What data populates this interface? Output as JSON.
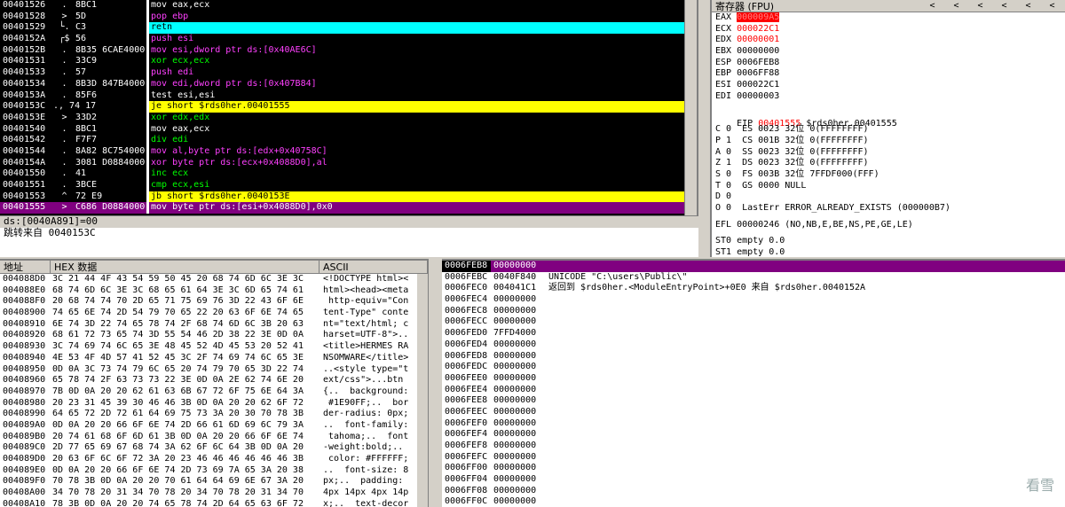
{
  "disasm": [
    {
      "addr": "00401526",
      "arrow": ".",
      "hex": "8BC1",
      "asm": "mov eax,ecx"
    },
    {
      "addr": "00401528",
      "arrow": ">",
      "hex": "5D",
      "asm": "pop ebp"
    },
    {
      "addr": "00401529",
      "arrow": "└.",
      "hex": "C3",
      "asm": "retn"
    },
    {
      "addr": "0040152A",
      "arrow": "┌$",
      "hex": "56",
      "asm": "push esi"
    },
    {
      "addr": "0040152B",
      "arrow": ".",
      "hex": "8B35 6CAE4000",
      "asm": "mov esi,dword ptr ds:[0x40AE6C]"
    },
    {
      "addr": "00401531",
      "arrow": ".",
      "hex": "33C9",
      "asm": "xor ecx,ecx"
    },
    {
      "addr": "00401533",
      "arrow": ".",
      "hex": "57",
      "asm": "push edi"
    },
    {
      "addr": "00401534",
      "arrow": ".",
      "hex": "8B3D 847B4000",
      "asm": "mov edi,dword ptr ds:[0x407B84]"
    },
    {
      "addr": "0040153A",
      "arrow": ".",
      "hex": "85F6",
      "asm": "test esi,esi"
    },
    {
      "addr": "0040153C",
      "arrow": "., 74 17",
      "hex": "",
      "asm": "je short $rds0her.00401555"
    },
    {
      "addr": "0040153E",
      "arrow": ">",
      "hex": "33D2",
      "asm": "xor edx,edx"
    },
    {
      "addr": "00401540",
      "arrow": ".",
      "hex": "8BC1",
      "asm": "mov eax,ecx"
    },
    {
      "addr": "00401542",
      "arrow": ".",
      "hex": "F7F7",
      "asm": "div edi"
    },
    {
      "addr": "00401544",
      "arrow": ".",
      "hex": "8A82 8C754000",
      "asm": "mov al,byte ptr ds:[edx+0x40758C]"
    },
    {
      "addr": "0040154A",
      "arrow": ".",
      "hex": "3081 D0884000",
      "asm": "xor byte ptr ds:[ecx+0x4088D0],al"
    },
    {
      "addr": "00401550",
      "arrow": ".",
      "hex": "41",
      "asm": "inc ecx"
    },
    {
      "addr": "00401551",
      "arrow": ".",
      "hex": "3BCE",
      "asm": "cmp ecx,esi"
    },
    {
      "addr": "00401553",
      "arrow": "^",
      "hex": "72 E9",
      "asm": "jb short $rds0her.0040153E"
    },
    {
      "addr": "00401555",
      "arrow": ">",
      "hex": "C686 D0884000",
      "asm": "mov byte ptr ds:[esi+0x4088D0],0x0"
    }
  ],
  "info": {
    "line1": "ds:[0040A891]=00",
    "line2": "跳转来自 0040153C"
  },
  "registers": {
    "title": "寄存器 (FPU)",
    "arrows": [
      "<",
      "<",
      "<",
      "<",
      "<",
      "<"
    ],
    "gp": [
      {
        "name": "EAX",
        "value": "000009A5"
      },
      {
        "name": "ECX",
        "value": "000022C1"
      },
      {
        "name": "EDX",
        "value": "00000001"
      },
      {
        "name": "EBX",
        "value": "00000000"
      },
      {
        "name": "ESP",
        "value": "0006FEB8"
      },
      {
        "name": "EBP",
        "value": "0006FF88"
      },
      {
        "name": "ESI",
        "value": "000022C1"
      },
      {
        "name": "EDI",
        "value": "00000003"
      }
    ],
    "eip": {
      "name": "EIP",
      "value": "00401555",
      "sym": "$rds0her.00401555"
    },
    "segs": [
      "C 0  ES 0023 32位 0(FFFFFFFF)",
      "P 1  CS 001B 32位 0(FFFFFFFF)",
      "A 0  SS 0023 32位 0(FFFFFFFF)",
      "Z 1  DS 0023 32位 0(FFFFFFFF)",
      "S 0  FS 003B 32位 7FFDF000(FFF)",
      "T 0  GS 0000 NULL",
      "D 0"
    ],
    "lasterr": "O 0  LastErr ERROR_ALREADY_EXISTS (000000B7)",
    "efl": "EFL 00000246 (NO,NB,E,BE,NS,PE,GE,LE)",
    "st0": "ST0 empty 0.0",
    "st1": "ST1 empty 0.0"
  },
  "dump": {
    "col_addr": "地址",
    "col_hex": "HEX 数据",
    "col_ascii": "ASCII",
    "rows": [
      {
        "addr": "004088D0",
        "hex": "3C 21 44 4F 43 54 59 50 45 20 68 74 6D 6C 3E 3C",
        "ascii": "<!DOCTYPE html><"
      },
      {
        "addr": "004088E0",
        "hex": "68 74 6D 6C 3E 3C 68 65 61 64 3E 3C 6D 65 74 61",
        "ascii": "html><head><meta"
      },
      {
        "addr": "004088F0",
        "hex": "20 68 74 74 70 2D 65 71 75 69 76 3D 22 43 6F 6E",
        "ascii": " http-equiv=\"Con"
      },
      {
        "addr": "00408900",
        "hex": "74 65 6E 74 2D 54 79 70 65 22 20 63 6F 6E 74 65",
        "ascii": "tent-Type\" conte"
      },
      {
        "addr": "00408910",
        "hex": "6E 74 3D 22 74 65 78 74 2F 68 74 6D 6C 3B 20 63",
        "ascii": "nt=\"text/html; c"
      },
      {
        "addr": "00408920",
        "hex": "68 61 72 73 65 74 3D 55 54 46 2D 38 22 3E 0D 0A",
        "ascii": "harset=UTF-8\">.."
      },
      {
        "addr": "00408930",
        "hex": "3C 74 69 74 6C 65 3E 48 45 52 4D 45 53 20 52 41",
        "ascii": "<title>HERMES RA"
      },
      {
        "addr": "00408940",
        "hex": "4E 53 4F 4D 57 41 52 45 3C 2F 74 69 74 6C 65 3E",
        "ascii": "NSOMWARE</title>"
      },
      {
        "addr": "00408950",
        "hex": "0D 0A 3C 73 74 79 6C 65 20 74 79 70 65 3D 22 74",
        "ascii": "..<style type=\"t"
      },
      {
        "addr": "00408960",
        "hex": "65 78 74 2F 63 73 73 22 3E 0D 0A 2E 62 74 6E 20",
        "ascii": "ext/css\">...btn "
      },
      {
        "addr": "00408970",
        "hex": "7B 0D 0A 20 20 62 61 63 6B 67 72 6F 75 6E 64 3A",
        "ascii": "{..  background:"
      },
      {
        "addr": "00408980",
        "hex": "20 23 31 45 39 30 46 46 3B 0D 0A 20 20 62 6F 72",
        "ascii": " #1E90FF;..  bor"
      },
      {
        "addr": "00408990",
        "hex": "64 65 72 2D 72 61 64 69 75 73 3A 20 30 70 78 3B",
        "ascii": "der-radius: 0px;"
      },
      {
        "addr": "004089A0",
        "hex": "0D 0A 20 20 66 6F 6E 74 2D 66 61 6D 69 6C 79 3A",
        "ascii": "..  font-family:"
      },
      {
        "addr": "004089B0",
        "hex": "20 74 61 68 6F 6D 61 3B 0D 0A 20 20 66 6F 6E 74",
        "ascii": " tahoma;..  font"
      },
      {
        "addr": "004089C0",
        "hex": "2D 77 65 69 67 68 74 3A 62 6F 6C 64 3B 0D 0A 20",
        "ascii": "-weight:bold;.. "
      },
      {
        "addr": "004089D0",
        "hex": "20 63 6F 6C 6F 72 3A 20 23 46 46 46 46 46 46 3B",
        "ascii": " color: #FFFFFF;"
      },
      {
        "addr": "004089E0",
        "hex": "0D 0A 20 20 66 6F 6E 74 2D 73 69 7A 65 3A 20 38",
        "ascii": "..  font-size: 8"
      },
      {
        "addr": "004089F0",
        "hex": "70 78 3B 0D 0A 20 20 70 61 64 64 69 6E 67 3A 20",
        "ascii": "px;..  padding: "
      },
      {
        "addr": "00408A00",
        "hex": "34 70 78 20 31 34 70 78 20 34 70 78 20 31 34 70",
        "ascii": "4px 14px 4px 14p"
      },
      {
        "addr": "00408A10",
        "hex": "78 3B 0D 0A 20 20 74 65 78 74 2D 64 65 63 6F 72",
        "ascii": "x;..  text-decor"
      }
    ]
  },
  "stack": [
    {
      "addr": "0006FEB8",
      "val": "00000000",
      "com": ""
    },
    {
      "addr": "0006FEBC",
      "val": "0040F840",
      "com": "UNICODE \"C:\\users\\Public\\\""
    },
    {
      "addr": "0006FEC0",
      "val": "004041C1",
      "com": "返回到 $rds0her.<ModuleEntryPoint>+0E0 来自 $rds0her.0040152A"
    },
    {
      "addr": "0006FEC4",
      "val": "00000000",
      "com": ""
    },
    {
      "addr": "0006FEC8",
      "val": "00000000",
      "com": ""
    },
    {
      "addr": "0006FECC",
      "val": "00000000",
      "com": ""
    },
    {
      "addr": "0006FED0",
      "val": "7FFD4000",
      "com": ""
    },
    {
      "addr": "0006FED4",
      "val": "00000000",
      "com": ""
    },
    {
      "addr": "0006FED8",
      "val": "00000000",
      "com": ""
    },
    {
      "addr": "0006FEDC",
      "val": "00000000",
      "com": ""
    },
    {
      "addr": "0006FEE0",
      "val": "00000000",
      "com": ""
    },
    {
      "addr": "0006FEE4",
      "val": "00000000",
      "com": ""
    },
    {
      "addr": "0006FEE8",
      "val": "00000000",
      "com": ""
    },
    {
      "addr": "0006FEEC",
      "val": "00000000",
      "com": ""
    },
    {
      "addr": "0006FEF0",
      "val": "00000000",
      "com": ""
    },
    {
      "addr": "0006FEF4",
      "val": "00000000",
      "com": ""
    },
    {
      "addr": "0006FEF8",
      "val": "00000000",
      "com": ""
    },
    {
      "addr": "0006FEFC",
      "val": "00000000",
      "com": ""
    },
    {
      "addr": "0006FF00",
      "val": "00000000",
      "com": ""
    },
    {
      "addr": "0006FF04",
      "val": "00000000",
      "com": ""
    },
    {
      "addr": "0006FF08",
      "val": "00000000",
      "com": ""
    },
    {
      "addr": "0006FF0C",
      "val": "00000000",
      "com": ""
    }
  ],
  "watermark": "看雪"
}
